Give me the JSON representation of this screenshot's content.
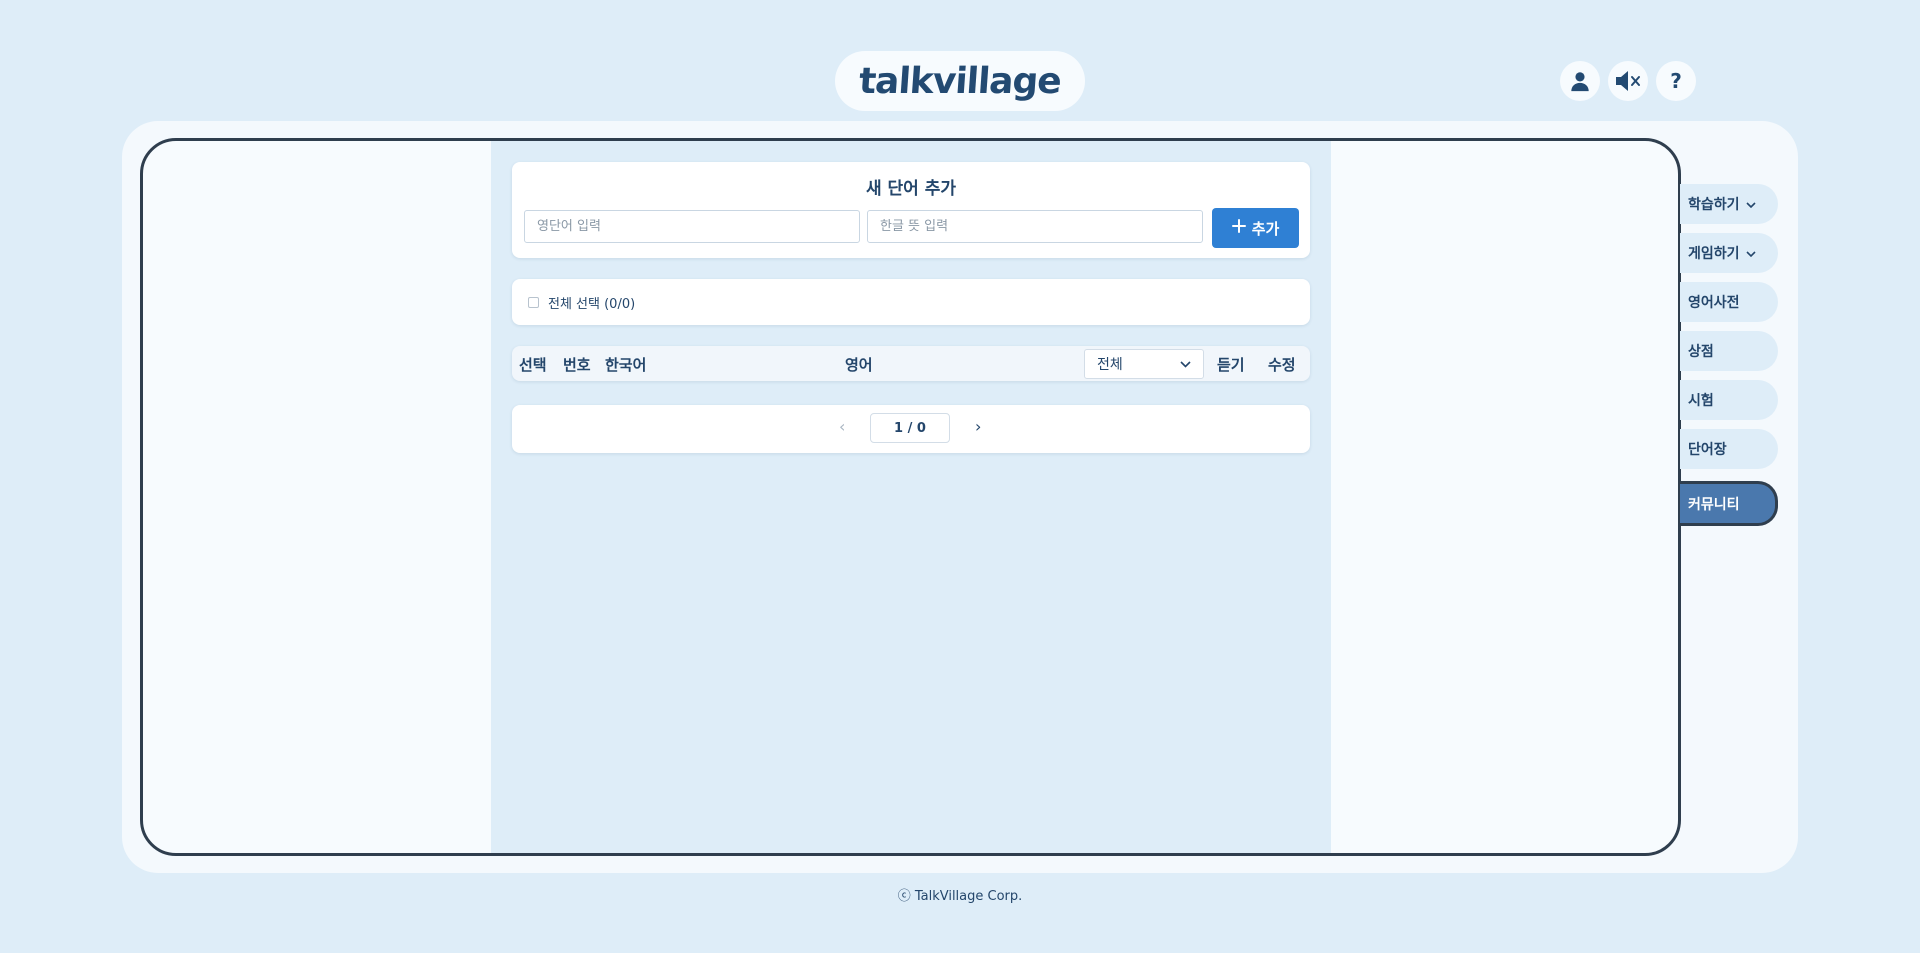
{
  "header": {
    "logo_text": "talkvillage",
    "icons": [
      "user-icon",
      "mute-icon",
      "help-icon"
    ],
    "help_label": "?"
  },
  "add_word": {
    "title": "새 단어 추가",
    "english_placeholder": "영단어 입력",
    "korean_placeholder": "한글 뜻 입력",
    "add_button_label": "추가"
  },
  "select_all": {
    "label": "전체 선택 (0/0)",
    "checked": false
  },
  "table": {
    "columns": [
      "선택",
      "번호",
      "한국어",
      "영어",
      "듣기",
      "수정"
    ],
    "filter_value": "전체",
    "rows": []
  },
  "pagination": {
    "prev": "‹",
    "next": "›",
    "label": "1 / 0"
  },
  "nav": {
    "items": [
      {
        "label": "학습하기",
        "has_dropdown": true
      },
      {
        "label": "게임하기",
        "has_dropdown": true
      },
      {
        "label": "영어사전",
        "has_dropdown": false
      },
      {
        "label": "상점",
        "has_dropdown": false
      },
      {
        "label": "시험",
        "has_dropdown": false
      },
      {
        "label": "단어장",
        "has_dropdown": false
      },
      {
        "label": "커뮤니티",
        "has_dropdown": false
      }
    ],
    "active": "커뮤니티",
    "chevron": "⌄"
  },
  "footer": {
    "text": "ⓒ TalkVillage Corp."
  },
  "colors": {
    "background": "#deedf8",
    "primary": "#2f80d4",
    "active_nav": "#4a78ad",
    "text": "#24466b"
  }
}
